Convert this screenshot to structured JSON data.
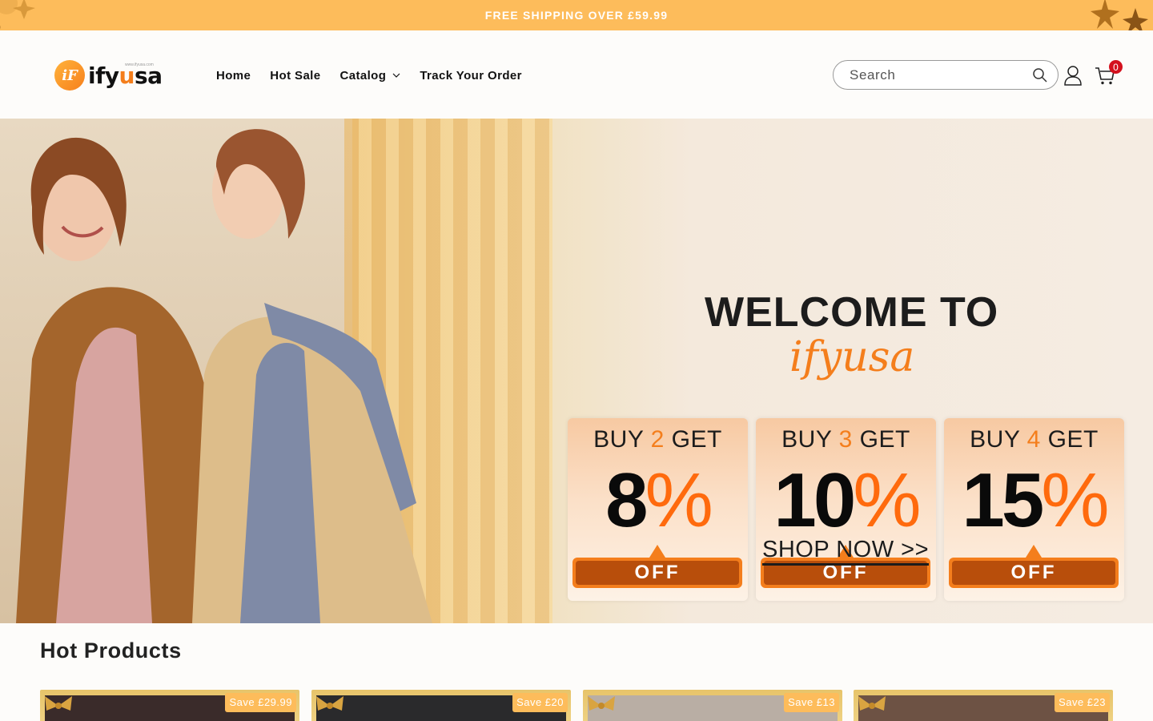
{
  "announcement": {
    "text": "FREE SHIPPING OVER £59.99"
  },
  "header": {
    "brand": {
      "name_part1": "ify",
      "name_part2": "u",
      "name_part3": "sa",
      "tagline": "www.ifyusa.com"
    },
    "nav": [
      {
        "label": "Home"
      },
      {
        "label": "Hot Sale"
      },
      {
        "label": "Catalog",
        "has_dropdown": true
      },
      {
        "label": "Track Your Order"
      }
    ],
    "search": {
      "placeholder": "Search"
    },
    "cart": {
      "count": "0"
    }
  },
  "hero": {
    "title": "WELCOME TO",
    "brand_script": "ifyusa",
    "offers": [
      {
        "buy_prefix": "BUY",
        "qty": "2",
        "buy_suffix": "GET",
        "percent": "8",
        "sign": "%",
        "off": "OFF"
      },
      {
        "buy_prefix": "BUY",
        "qty": "3",
        "buy_suffix": "GET",
        "percent": "10",
        "sign": "%",
        "off": "OFF"
      },
      {
        "buy_prefix": "BUY",
        "qty": "4",
        "buy_suffix": "GET",
        "percent": "15",
        "sign": "%",
        "off": "OFF"
      }
    ],
    "cta": "SHOP NOW >>"
  },
  "hot_products": {
    "title": "Hot Products",
    "items": [
      {
        "save": "Save £29.99",
        "photo_tone": "#3a2b2a"
      },
      {
        "save": "Save £20",
        "photo_tone": "#2a2a2c"
      },
      {
        "save": "Save £13",
        "photo_tone": "#b9aea4"
      },
      {
        "save": "Save £23",
        "photo_tone": "#6d5244"
      }
    ]
  },
  "colors": {
    "accent": "#fdbc5b",
    "brand_orange": "#f47e1c",
    "badge_red": "#d4111e"
  }
}
